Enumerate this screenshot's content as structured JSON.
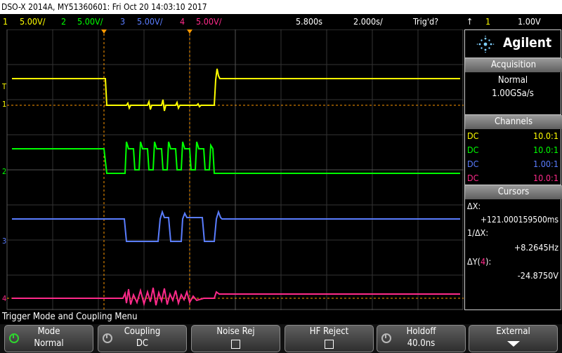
{
  "title_bar": "DSO-X 2014A, MY51360601: Fri Oct 20 14:03:10 2017",
  "channel_bar": {
    "ch1": {
      "num": "1",
      "scale": "5.00V/",
      "color": "#ffff00"
    },
    "ch2": {
      "num": "2",
      "scale": "5.00V/",
      "color": "#00ff00"
    },
    "ch3": {
      "num": "3",
      "scale": "5.00V/",
      "color": "#5a7dff"
    },
    "ch4": {
      "num": "4",
      "scale": "5.00V/",
      "color": "#ff2a8a"
    },
    "time_delay": "5.800s",
    "time_scale": "2.000s/",
    "trigger_status": "Trig'd?",
    "trigger_slope": "↑",
    "trigger_channel": "1",
    "trigger_level": "1.00V"
  },
  "brand": "Agilent",
  "acquisition": {
    "header": "Acquisition",
    "mode": "Normal",
    "rate": "1.00GSa/s"
  },
  "channels": {
    "header": "Channels",
    "rows": [
      {
        "coupling": "DC",
        "probe": "10.0:1",
        "color": "#ffff00"
      },
      {
        "coupling": "DC",
        "probe": "10.0:1",
        "color": "#00ff00"
      },
      {
        "coupling": "DC",
        "probe": "1.00:1",
        "color": "#5a7dff"
      },
      {
        "coupling": "DC",
        "probe": "10.0:1",
        "color": "#ff2a8a"
      }
    ]
  },
  "cursors": {
    "header": "Cursors",
    "dx_label": "ΔX:",
    "dx_value": "+121.000159500ms",
    "inv_dx_label": "1/ΔX:",
    "inv_dx_value": "+8.2645Hz",
    "dy_label_prefix": "ΔY(",
    "dy_channel": "4",
    "dy_label_suffix": "):",
    "dy_value": "-24.8750V"
  },
  "markers": {
    "ch1": "1",
    "ch2": "2",
    "ch3": "3",
    "ch4": "4",
    "trigger": "T"
  },
  "menu_label": "Trigger Mode and Coupling Menu",
  "softkeys": [
    {
      "title": "Mode",
      "value": "Normal"
    },
    {
      "title": "Coupling",
      "value": "DC"
    },
    {
      "title": "Noise Rej"
    },
    {
      "title": "HF Reject"
    },
    {
      "title": "Holdoff",
      "value": "40.0ns"
    },
    {
      "title": "External"
    }
  ]
}
